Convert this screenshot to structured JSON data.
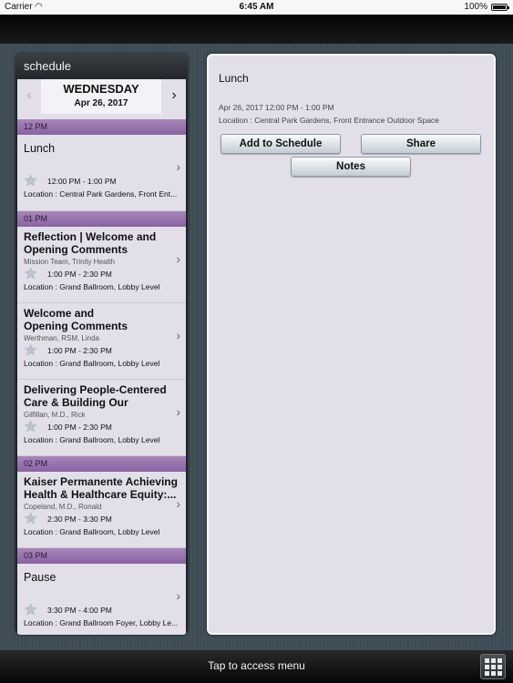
{
  "status_bar": {
    "carrier": "Carrier",
    "time": "6:45 AM",
    "battery": "100%"
  },
  "sidebar": {
    "title": "schedule",
    "day": "WEDNESDAY",
    "date": "Apr 26, 2017"
  },
  "schedule": {
    "sections": [
      "12 PM",
      "01 PM",
      "02 PM",
      "03 PM"
    ],
    "items": [
      {
        "title": "Lunch",
        "speaker": "",
        "time": "12:00 PM - 1:00 PM",
        "location": "Location : Central Park Gardens, Front Ent..."
      },
      {
        "title": "Reflection | Welcome and Opening Comments",
        "speaker": "Mission Team, Trinity Health",
        "time": "1:00 PM - 2:30 PM",
        "location": "Location : Grand Ballroom, Lobby Level"
      },
      {
        "title": "Welcome and Opening Comments",
        "speaker": "Werthman, RSM, Linda",
        "time": "1:00 PM - 2:30 PM",
        "location": "Location : Grand Ballroom, Lobby Level"
      },
      {
        "title": "Delivering People-Centered Care & Building Our People-...",
        "speaker": "Gilfillan, M.D., Rick",
        "time": "1:00 PM - 2:30 PM",
        "location": "Location : Grand Ballroom, Lobby Level"
      },
      {
        "title": "Kaiser Permanente Achieving Health & Healthcare Equity:...",
        "speaker": "Copeland, M.D., Ronald",
        "time": "2:30 PM - 3:30 PM",
        "location": "Location : Grand Ballroom, Lobby Level"
      },
      {
        "title": "Pause",
        "speaker": "",
        "time": "3:30 PM - 4:00 PM",
        "location": "Location : Grand Ballroom Foyer, Lobby Le..."
      }
    ]
  },
  "detail": {
    "title": "Lunch",
    "datetime": "Apr 26, 2017 12:00 PM - 1:00 PM",
    "location": "Location : Central Park Gardens, Front Entrance Outdoor Space",
    "buttons": {
      "add": "Add to Schedule",
      "share": "Share",
      "notes": "Notes"
    }
  },
  "bottom_bar": {
    "menu_text": "Tap to access menu"
  },
  "icons": {
    "star": "star-icon",
    "chevron": "chevron-right-icon",
    "prev": "chevron-left-icon",
    "grid": "grid-menu-icon",
    "wifi": "wifi-icon",
    "battery": "battery-icon"
  },
  "colors": {
    "section_header": "#8a62a3",
    "list_bg": "#e2dfe9"
  }
}
